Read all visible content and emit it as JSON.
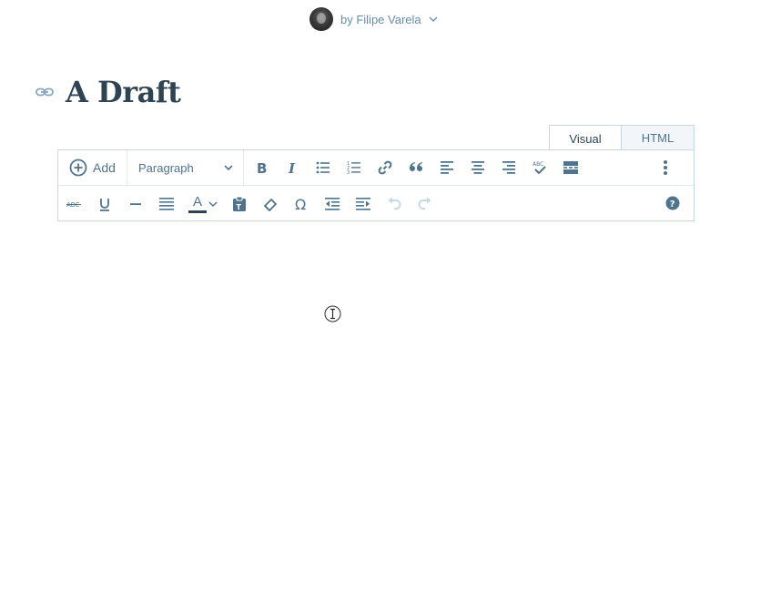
{
  "author": {
    "label": "by Filipe Varela"
  },
  "post": {
    "title": "A Draft"
  },
  "mode_tabs": {
    "visual": "Visual",
    "html": "HTML",
    "active": "Visual"
  },
  "toolbar": {
    "add_label": "Add",
    "format_value": "Paragraph",
    "text_color_label": "A",
    "buttons_row1": [
      "bold-icon",
      "italic-icon",
      "bullet-list-icon",
      "numbered-list-icon",
      "link-icon",
      "blockquote-icon",
      "align-left-icon",
      "align-center-icon",
      "align-right-icon",
      "spellcheck-icon",
      "read-more-icon",
      "more-vertical-icon"
    ],
    "buttons_row2": [
      "strikethrough-icon",
      "underline-icon",
      "horizontal-rule-icon",
      "justify-icon",
      "text-color-icon",
      "paste-text-icon",
      "clear-formatting-icon",
      "special-character-icon",
      "outdent-icon",
      "indent-icon",
      "undo-icon",
      "redo-icon",
      "help-icon"
    ]
  },
  "colors": {
    "primary_text": "#2e4453",
    "icon": "#4f748e",
    "border": "#c8d7e1",
    "disabled": "#c8d7e1"
  }
}
